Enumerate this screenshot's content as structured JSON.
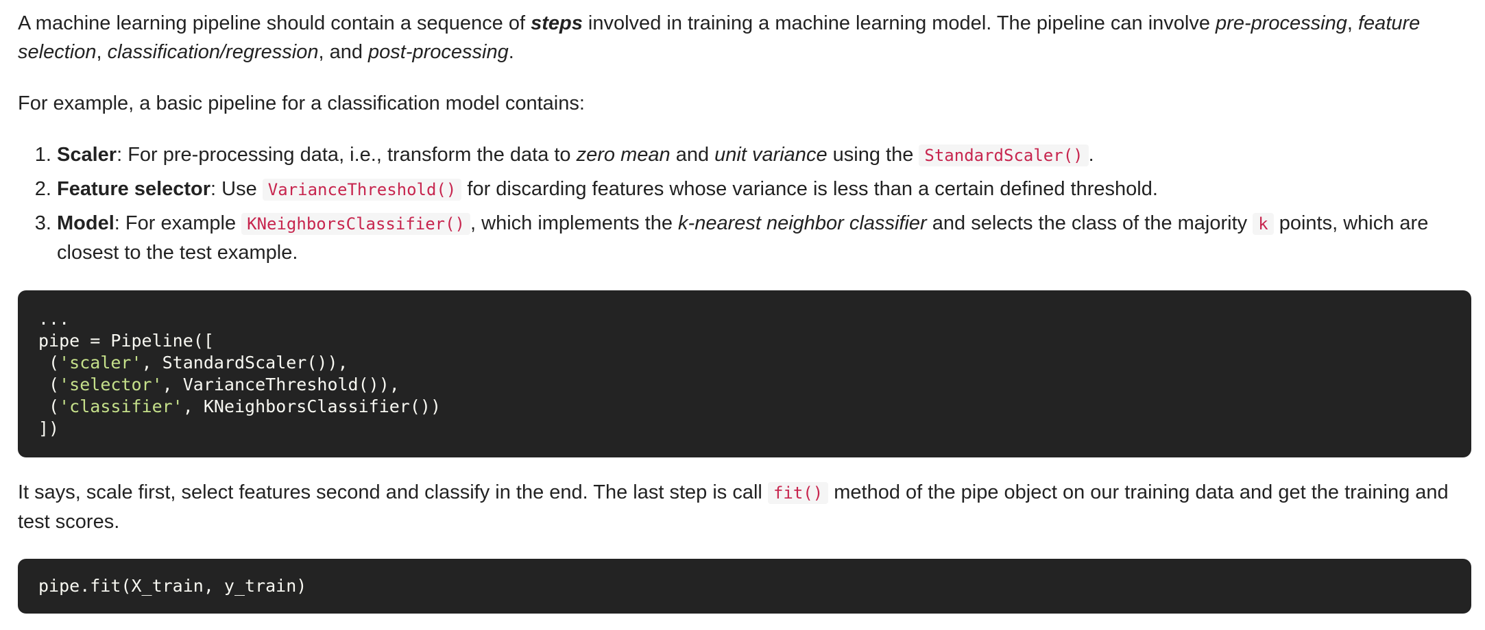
{
  "intro": {
    "t1": "A machine learning pipeline should contain a sequence of ",
    "steps_word": "steps",
    "t2": " involved in training a machine learning model. The pipeline can involve ",
    "stage1": "pre-processing",
    "sep1": ", ",
    "stage2": "feature selection",
    "sep2": ", ",
    "stage3": "classification/regression",
    "sep3": ", and ",
    "stage4": "post-processing",
    "end": "."
  },
  "example_intro": "For example, a basic pipeline for a classification model contains:",
  "steps": [
    {
      "term": "Scaler",
      "t1": ": For pre-processing data, i.e., transform the data to ",
      "em1": "zero mean",
      "t2": " and ",
      "em2": "unit variance",
      "t3": " using the ",
      "code": "StandardScaler()",
      "t4": "."
    },
    {
      "term": "Feature selector",
      "t1": ": Use ",
      "code": "VarianceThreshold()",
      "t2": " for discarding features whose variance is less than a certain defined threshold."
    },
    {
      "term": "Model",
      "t1": ": For example ",
      "code": "KNeighborsClassifier()",
      "t2": ", which implements the ",
      "em1": "k-nearest neighbor classifier",
      "t3": " and selects the class of the majority ",
      "code2": "k",
      "t4": " points, which are closest to the test example."
    }
  ],
  "code_block_1": {
    "l1": "...",
    "l2": "pipe = Pipeline([",
    "l3_open": " (",
    "l3_str": "'scaler'",
    "l3_rest": ", StandardScaler()),",
    "l4_open": " (",
    "l4_str": "'selector'",
    "l4_rest": ", VarianceThreshold()),",
    "l5_open": " (",
    "l5_str": "'classifier'",
    "l5_rest": ", KNeighborsClassifier())",
    "l6": "])"
  },
  "after_code": {
    "t1": "It says, scale first, select features second and classify in the end. The last step is call ",
    "code": "fit()",
    "t2": " method of the pipe object on our training data and get the training and test scores."
  },
  "code_block_2": {
    "l1": "pipe.fit(X_train, y_train)"
  },
  "colors": {
    "code_bg": "#232323",
    "code_text": "#f8f8f2",
    "code_string": "#c5e08a",
    "inline_code": "#c7254e",
    "inline_code_bg": "#f5f5f5",
    "text": "#222222"
  }
}
